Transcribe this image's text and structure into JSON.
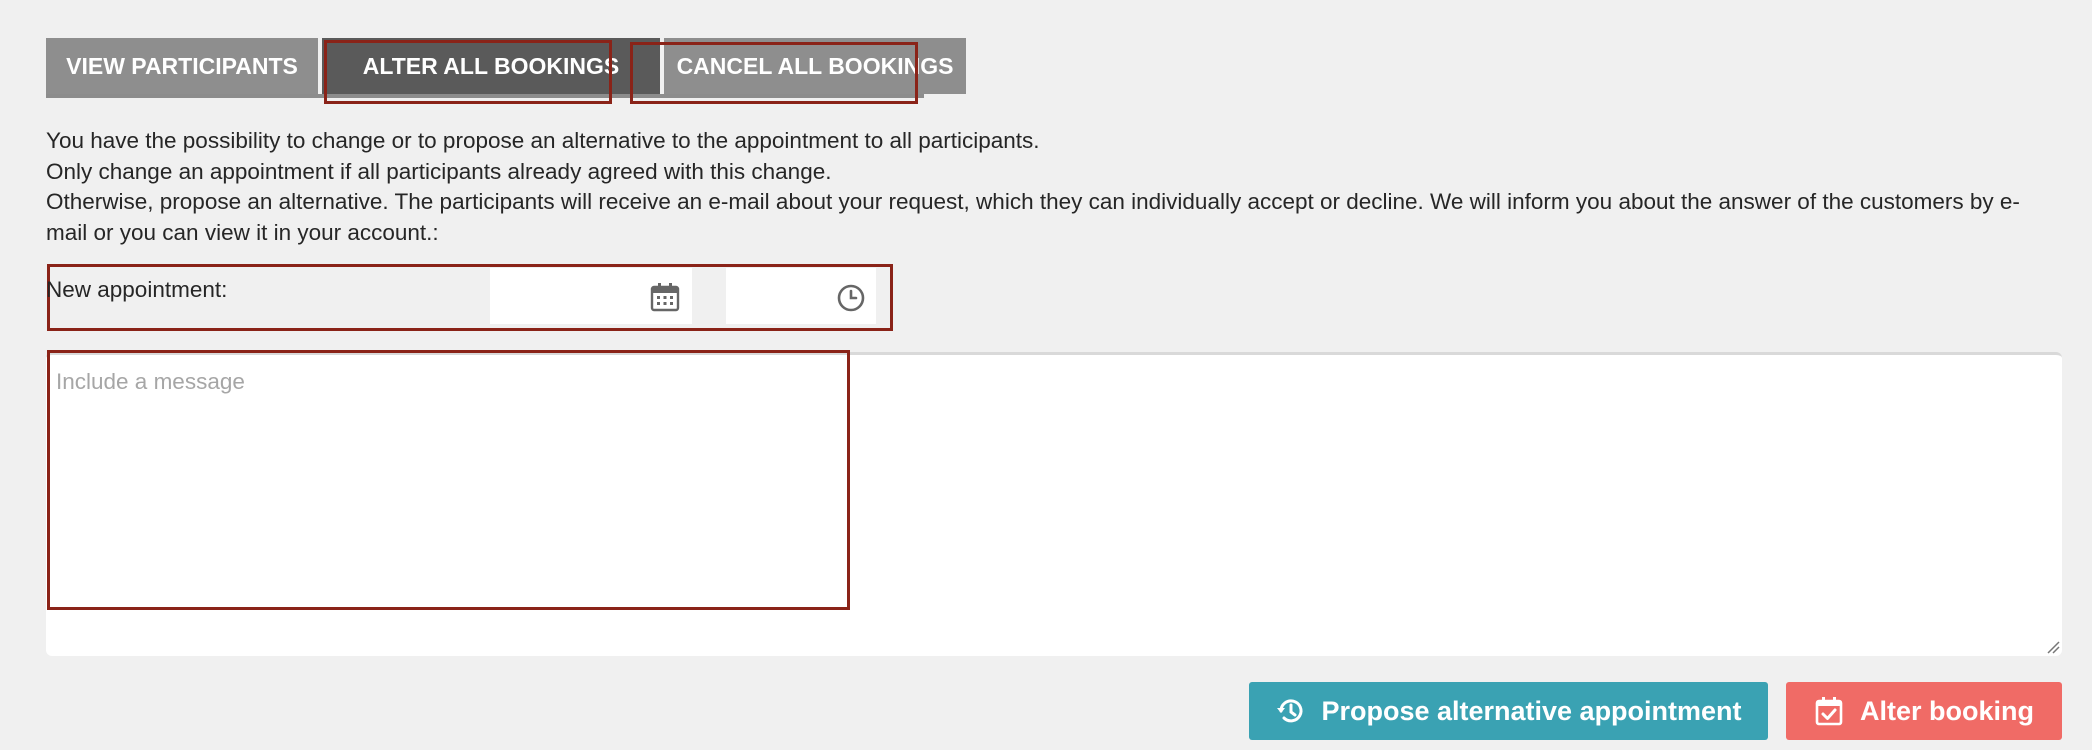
{
  "tabs": {
    "view_participants": "VIEW PARTICIPANTS",
    "alter_all_bookings": "ALTER ALL BOOKINGS",
    "cancel_all_bookings": "CANCEL ALL BOOKINGS"
  },
  "intro": {
    "line1": "You have the possibility to change or to propose an alternative to the appointment to all participants.",
    "line2": "Only change an appointment if all participants already agreed with this change.",
    "line3": "Otherwise, propose an alternative. The participants will receive an e-mail about your request, which they can individually accept or decline. We will inform you about the answer of the customers by e-mail or you can view it in your account.:"
  },
  "appointment": {
    "label": "New appointment:",
    "date_value": "",
    "time_value": "",
    "date_icon": "calendar-icon",
    "time_icon": "clock-icon"
  },
  "message": {
    "placeholder": "Include a message",
    "value": ""
  },
  "buttons": {
    "propose_label": "Propose alternative appointment",
    "propose_icon": "history-icon",
    "alter_label": "Alter booking",
    "alter_icon": "calendar-check-icon"
  },
  "colors": {
    "tab_inactive": "#8e8e8e",
    "tab_active": "#5a5a5a",
    "highlight_border": "#8a2318",
    "propose_button": "#3aa2b3",
    "alter_button": "#f06b66",
    "background": "#f0f0f0"
  }
}
